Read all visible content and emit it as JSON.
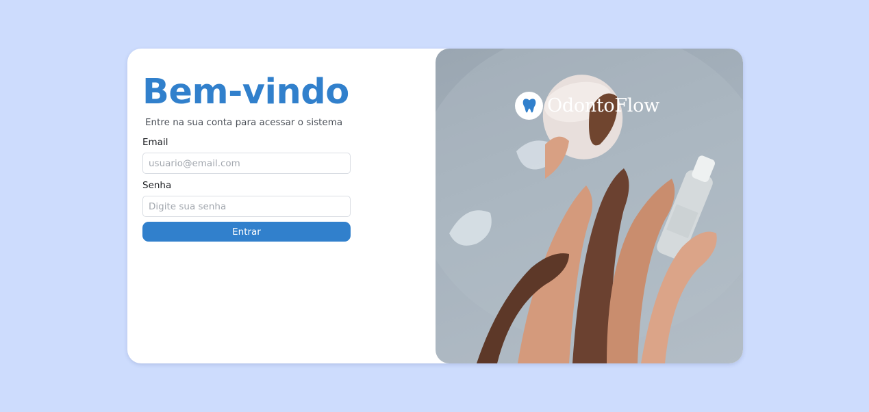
{
  "page": {
    "background_color": "#cddcfd",
    "accent_color": "#3180cc"
  },
  "login": {
    "title": "Bem-vindo",
    "subtitle": "Entre na sua conta para acessar o sistema",
    "email_label": "Email",
    "email_placeholder": "usuario@email.com",
    "email_value": "",
    "password_label": "Senha",
    "password_placeholder": "Digite sua senha",
    "password_value": "",
    "submit_label": "Entrar"
  },
  "brand": {
    "name": "OdontoFlow",
    "icon": "tooth-icon"
  },
  "hero": {
    "icon": "dental-products-photo"
  }
}
